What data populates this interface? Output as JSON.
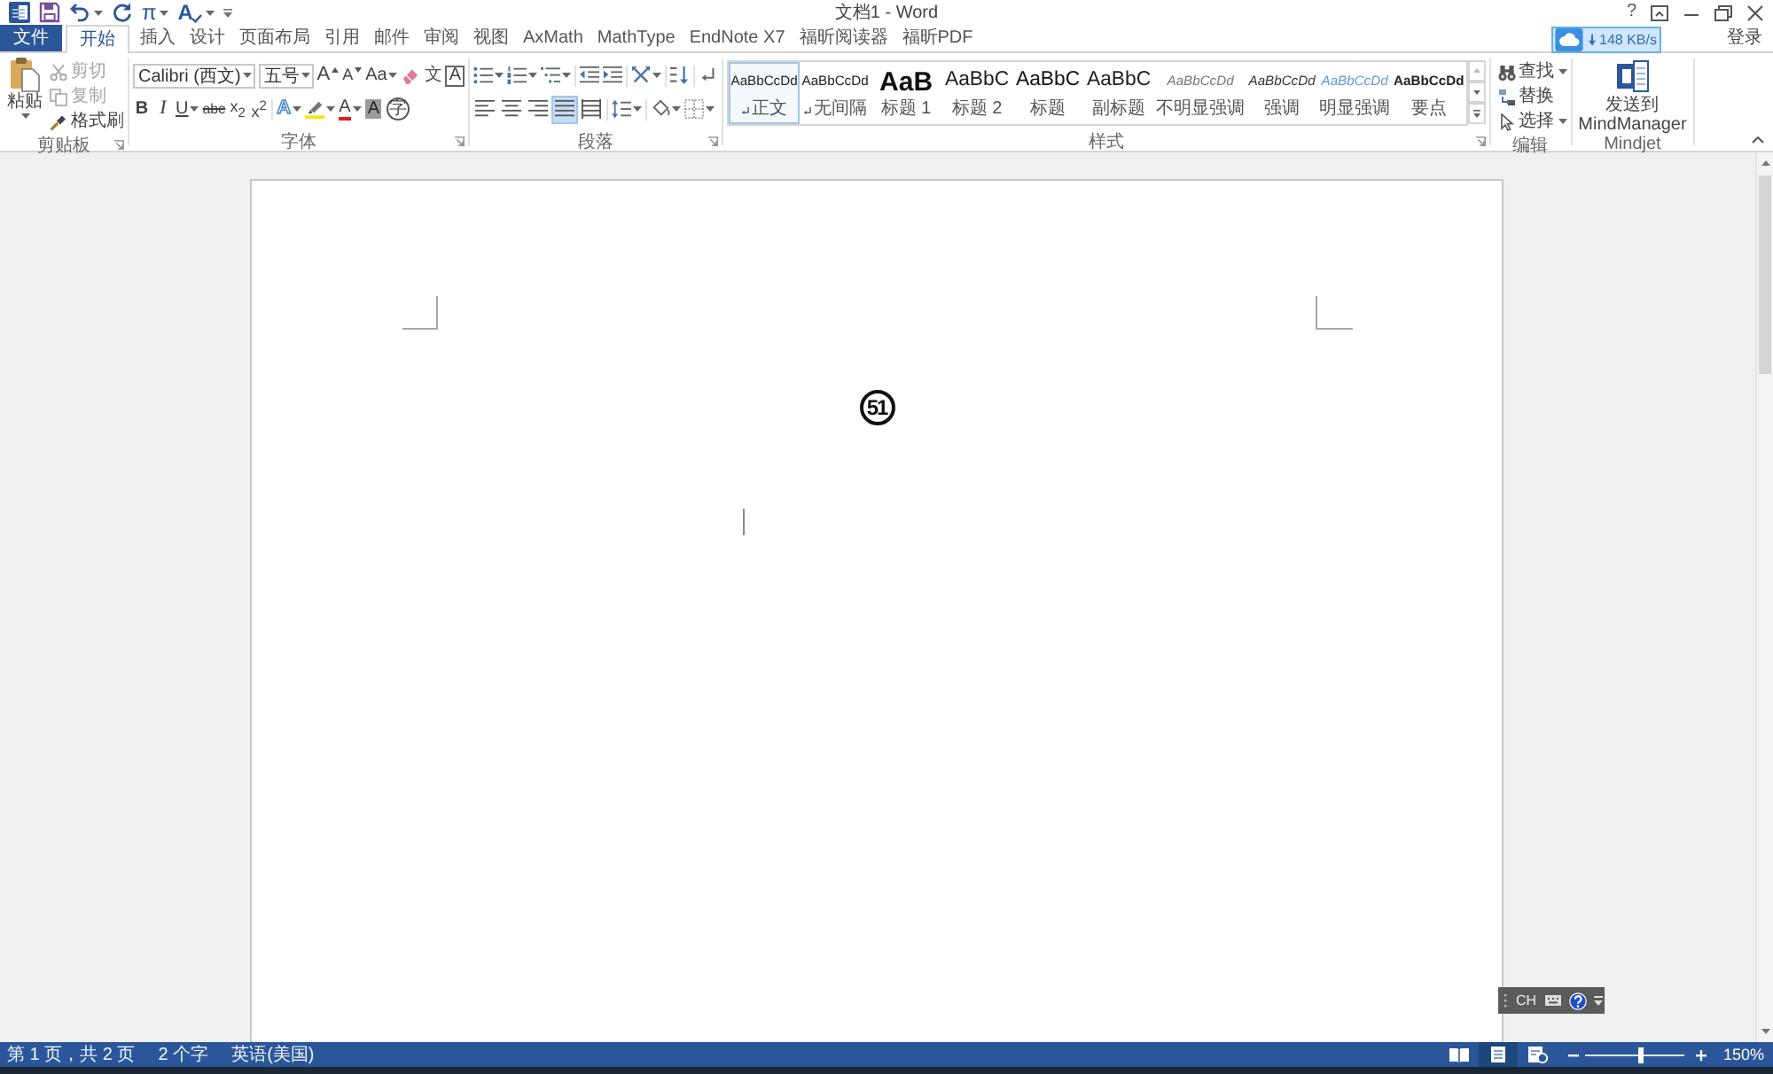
{
  "title_bar": {
    "equation": "π",
    "spelling": "A",
    "title": "文档1 - Word",
    "help": "?"
  },
  "tabs": [
    {
      "label": "文件",
      "kind": "file",
      "selected": false
    },
    {
      "label": "开始",
      "kind": "tab",
      "selected": true
    },
    {
      "label": "插入",
      "kind": "tab",
      "selected": false
    },
    {
      "label": "设计",
      "kind": "tab",
      "selected": false
    },
    {
      "label": "页面布局",
      "kind": "tab",
      "selected": false
    },
    {
      "label": "引用",
      "kind": "tab",
      "selected": false
    },
    {
      "label": "邮件",
      "kind": "tab",
      "selected": false
    },
    {
      "label": "审阅",
      "kind": "tab",
      "selected": false
    },
    {
      "label": "视图",
      "kind": "tab",
      "selected": false
    },
    {
      "label": "AxMath",
      "kind": "tab",
      "selected": false
    },
    {
      "label": "MathType",
      "kind": "tab",
      "selected": false
    },
    {
      "label": "EndNote X7",
      "kind": "tab",
      "selected": false
    },
    {
      "label": "福昕阅读器",
      "kind": "tab",
      "selected": false
    },
    {
      "label": "福昕PDF",
      "kind": "tab",
      "selected": false
    }
  ],
  "sign_in": "登录",
  "speed_badge": {
    "text": "148 KB/s"
  },
  "clipboard": {
    "paste": "粘贴",
    "items": [
      {
        "label": "剪切",
        "disabled": true
      },
      {
        "label": "复制",
        "disabled": true
      },
      {
        "label": "格式刷",
        "disabled": false
      }
    ],
    "label": "剪贴板"
  },
  "font": {
    "name": "Calibri (西文)",
    "size": "五号",
    "grow": "A",
    "shrink": "A",
    "case": "Aa",
    "phonetic": "文",
    "border": "A",
    "bold": "B",
    "italic": "I",
    "underline": "U",
    "strikethrough": "abc",
    "subscript": "x$_{2}$",
    "superscript": "x$^{2}$",
    "effects": "A",
    "font_color": "A",
    "shading": "A",
    "enclose": "字",
    "label": "字体"
  },
  "paragraph": {
    "alignments": [
      {
        "kind": "left",
        "selected": false
      },
      {
        "kind": "center",
        "selected": false
      },
      {
        "kind": "right",
        "selected": false
      },
      {
        "kind": "justify",
        "selected": true
      },
      {
        "kind": "distributed",
        "selected": false
      }
    ],
    "label": "段落"
  },
  "styles": {
    "items": [
      {
        "preview": "AaBbCcDd",
        "name": "正文",
        "kind": "normal",
        "para_mark": true,
        "selected": true
      },
      {
        "preview": "AaBbCcDd",
        "name": "无间隔",
        "kind": "normal",
        "para_mark": true,
        "selected": false
      },
      {
        "preview": "AaB",
        "name": "标题 1",
        "kind": "heading1",
        "para_mark": false,
        "selected": false
      },
      {
        "preview": "AaBbC",
        "name": "标题 2",
        "kind": "heading2",
        "para_mark": false,
        "selected": false
      },
      {
        "preview": "AaBbC",
        "name": "标题",
        "kind": "title",
        "para_mark": false,
        "selected": false
      },
      {
        "preview": "AaBbC",
        "name": "副标题",
        "kind": "subtitle",
        "para_mark": false,
        "selected": false
      },
      {
        "preview": "AaBbCcDd",
        "name": "不明显强调",
        "kind": "subtle",
        "para_mark": false,
        "selected": false
      },
      {
        "preview": "AaBbCcDd",
        "name": "强调",
        "kind": "emphasis",
        "para_mark": false,
        "selected": false
      },
      {
        "preview": "AaBbCcDd",
        "name": "明显强调",
        "kind": "intense",
        "para_mark": false,
        "selected": false
      },
      {
        "preview": "AaBbCcDd",
        "name": "要点",
        "kind": "strong",
        "para_mark": false,
        "selected": false
      }
    ],
    "label": "样式"
  },
  "editing": {
    "items": [
      {
        "label": "查找",
        "dropdown": true
      },
      {
        "label": "替换",
        "dropdown": false
      },
      {
        "label": "选择",
        "dropdown": true
      }
    ],
    "label": "编辑"
  },
  "mindjet": {
    "button": "发送到 MindManager",
    "label": "Mindjet"
  },
  "document": {
    "text": "51"
  },
  "language_bar": {
    "text": "CH"
  },
  "status_bar": {
    "page": "第 1 页，共 2 页",
    "words": "2 个字",
    "language": "英语(美国)",
    "views": [
      {
        "kind": "read",
        "selected": false
      },
      {
        "kind": "print",
        "selected": true
      },
      {
        "kind": "web",
        "selected": false
      }
    ],
    "zoom": {
      "level": 0.55,
      "reading": "150%"
    }
  }
}
